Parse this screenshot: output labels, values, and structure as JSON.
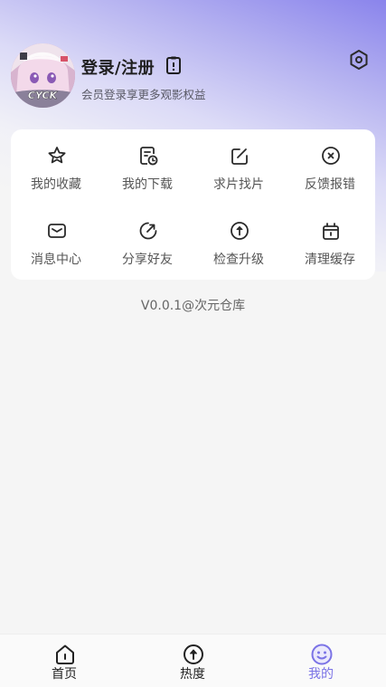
{
  "profile": {
    "title": "登录/注册",
    "subtitle": "会员登录享更多观影权益",
    "avatar_text": "CYCK"
  },
  "grid": {
    "items": [
      {
        "label": "我的收藏",
        "icon": "star-icon"
      },
      {
        "label": "我的下载",
        "icon": "download-icon"
      },
      {
        "label": "求片找片",
        "icon": "edit-icon"
      },
      {
        "label": "反馈报错",
        "icon": "close-circle-icon"
      },
      {
        "label": "消息中心",
        "icon": "mail-icon"
      },
      {
        "label": "分享好友",
        "icon": "share-icon"
      },
      {
        "label": "检查升级",
        "icon": "upgrade-icon"
      },
      {
        "label": "清理缓存",
        "icon": "trash-icon"
      }
    ]
  },
  "version": "V0.0.1@次元仓库",
  "tabs": [
    {
      "label": "首页",
      "icon": "home-icon",
      "active": false
    },
    {
      "label": "热度",
      "icon": "hot-icon",
      "active": false
    },
    {
      "label": "我的",
      "icon": "profile-smile-icon",
      "active": true
    }
  ],
  "colors": {
    "accent": "#7b73e6",
    "hero_top": "#8a84ec",
    "background": "#f5f5f5",
    "card": "#ffffff"
  }
}
